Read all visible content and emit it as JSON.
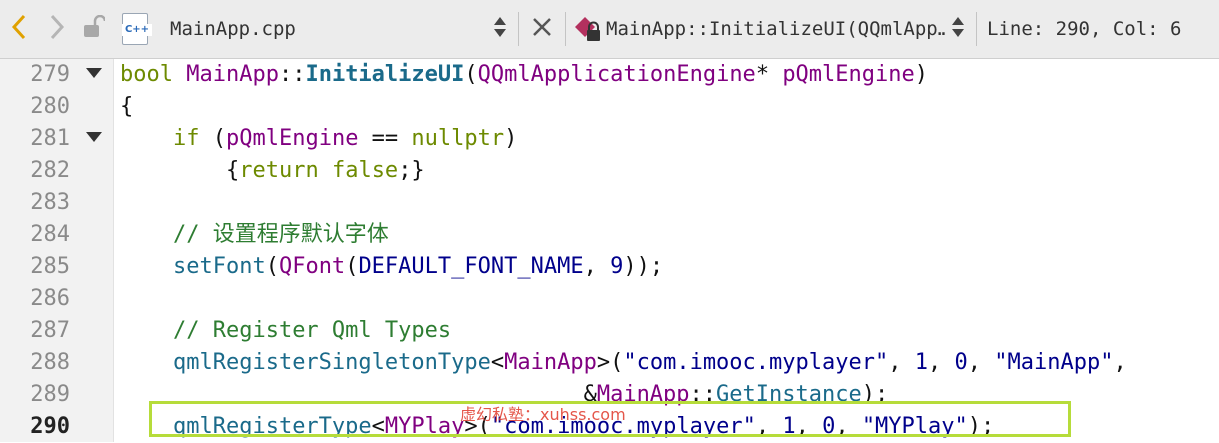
{
  "toolbar": {
    "file_name": "MainApp.cpp",
    "file_type_badge": "C++",
    "symbol": "MainApp::InitializeUI(QQmlApp…",
    "position": "Line: 290, Col: 6"
  },
  "icons": {
    "back": "chevron-left-icon",
    "forward": "chevron-right-icon",
    "lock": "lock-icon",
    "file": "cpp-file-icon",
    "updown": "up-down-arrows-icon",
    "close": "close-icon",
    "symbol": "locked-method-icon"
  },
  "colors": {
    "keyword": "#6d8a00",
    "type": "#800080",
    "function": "#1a6a8a",
    "string": "#00008b",
    "comment": "#2e7d32",
    "highlight_box": "#b6dc3a",
    "back_arrow": "#e0a100"
  },
  "editor": {
    "current_line": "290",
    "lines": [
      {
        "number": "279",
        "folded_marker": true,
        "tokens": [
          [
            "k",
            "bool"
          ],
          [
            "p",
            " "
          ],
          [
            "t",
            "MainApp"
          ],
          [
            "p",
            "::"
          ],
          [
            "fb",
            "InitializeUI"
          ],
          [
            "p",
            "("
          ],
          [
            "t",
            "QQmlApplicationEngine"
          ],
          [
            "p",
            "* "
          ],
          [
            "t",
            "pQmlEngine"
          ],
          [
            "p",
            ")"
          ]
        ]
      },
      {
        "number": "280",
        "folded_marker": false,
        "tokens": [
          [
            "p",
            "{"
          ]
        ]
      },
      {
        "number": "281",
        "folded_marker": true,
        "tokens": [
          [
            "p",
            "    "
          ],
          [
            "k",
            "if"
          ],
          [
            "p",
            " ("
          ],
          [
            "t",
            "pQmlEngine"
          ],
          [
            "p",
            " == "
          ],
          [
            "k",
            "nullptr"
          ],
          [
            "p",
            ")"
          ]
        ]
      },
      {
        "number": "282",
        "folded_marker": false,
        "tokens": [
          [
            "p",
            "        {"
          ],
          [
            "k",
            "return"
          ],
          [
            "p",
            " "
          ],
          [
            "k",
            "false"
          ],
          [
            "p",
            ";}"
          ]
        ]
      },
      {
        "number": "283",
        "folded_marker": false,
        "tokens": []
      },
      {
        "number": "284",
        "folded_marker": false,
        "tokens": [
          [
            "p",
            "    "
          ],
          [
            "c",
            "// 设置程序默认字体"
          ]
        ]
      },
      {
        "number": "285",
        "folded_marker": false,
        "tokens": [
          [
            "p",
            "    "
          ],
          [
            "f",
            "setFont"
          ],
          [
            "p",
            "("
          ],
          [
            "t",
            "QFont"
          ],
          [
            "p",
            "("
          ],
          [
            "n",
            "DEFAULT_FONT_NAME"
          ],
          [
            "p",
            ", "
          ],
          [
            "n",
            "9"
          ],
          [
            "p",
            "));"
          ]
        ]
      },
      {
        "number": "286",
        "folded_marker": false,
        "tokens": []
      },
      {
        "number": "287",
        "folded_marker": false,
        "tokens": [
          [
            "p",
            "    "
          ],
          [
            "c",
            "// Register Qml Types"
          ]
        ]
      },
      {
        "number": "288",
        "folded_marker": false,
        "tokens": [
          [
            "p",
            "    "
          ],
          [
            "f",
            "qmlRegisterSingletonType"
          ],
          [
            "p",
            "<"
          ],
          [
            "t",
            "MainApp"
          ],
          [
            "p",
            ">("
          ],
          [
            "s",
            "\"com.imooc.myplayer\""
          ],
          [
            "p",
            ", "
          ],
          [
            "n",
            "1"
          ],
          [
            "p",
            ", "
          ],
          [
            "n",
            "0"
          ],
          [
            "p",
            ", "
          ],
          [
            "s",
            "\"MainApp\""
          ],
          [
            "p",
            ","
          ]
        ]
      },
      {
        "number": "289",
        "folded_marker": false,
        "tokens": [
          [
            "p",
            "                                   &"
          ],
          [
            "t",
            "MainApp"
          ],
          [
            "p",
            "::"
          ],
          [
            "f",
            "GetInstance"
          ],
          [
            "p",
            ");"
          ]
        ]
      },
      {
        "number": "290",
        "folded_marker": false,
        "tokens": [
          [
            "p",
            "    "
          ],
          [
            "f",
            "qmlRegisterType"
          ],
          [
            "p",
            "<"
          ],
          [
            "t",
            "MYPlay"
          ],
          [
            "p",
            ">("
          ],
          [
            "s",
            "\"com.imooc.myplayer\""
          ],
          [
            "p",
            ", "
          ],
          [
            "n",
            "1"
          ],
          [
            "p",
            ", "
          ],
          [
            "n",
            "0"
          ],
          [
            "p",
            ", "
          ],
          [
            "s",
            "\"MYPlay\""
          ],
          [
            "p",
            ");"
          ]
        ]
      }
    ]
  },
  "watermark": "虚幻私塾：xuhss.com"
}
